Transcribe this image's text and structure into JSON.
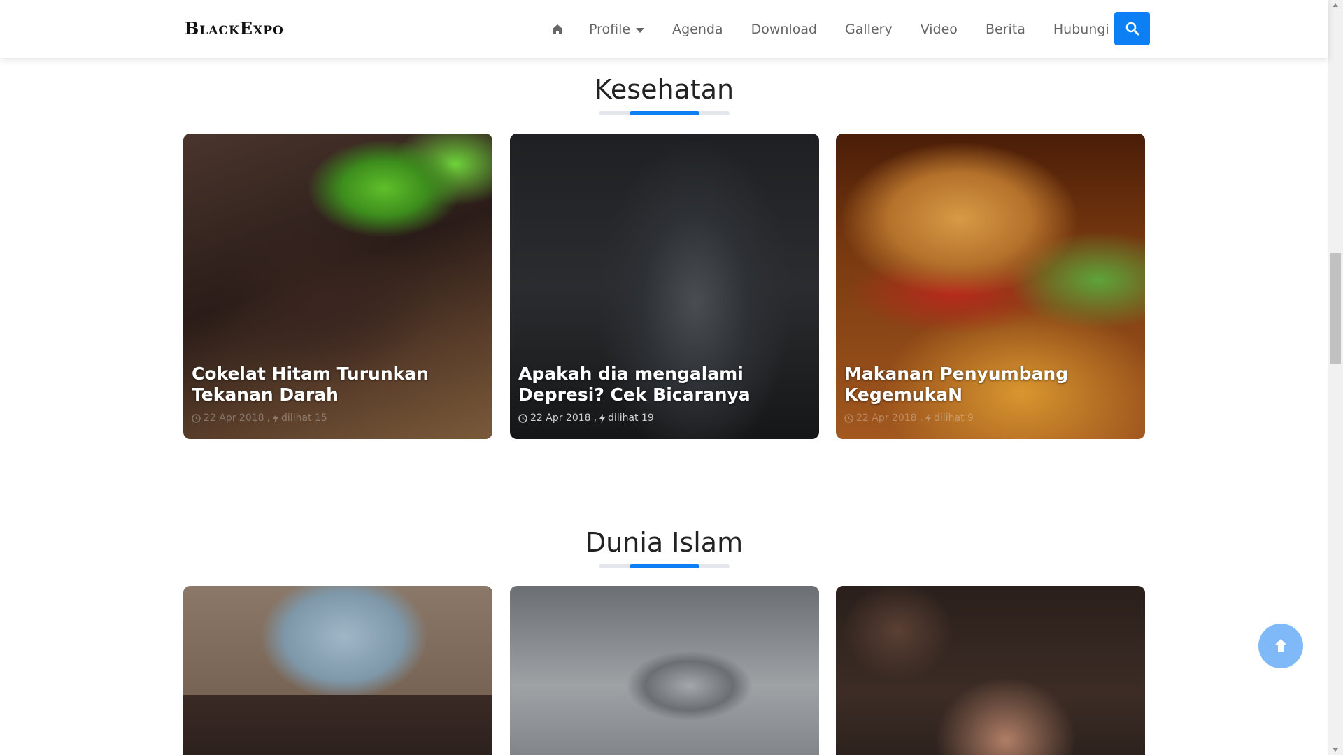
{
  "brand": "BlackExpo",
  "nav": {
    "home_icon": "home-icon",
    "items": [
      "Profile",
      "Agenda",
      "Download",
      "Gallery",
      "Video",
      "Berita",
      "Hubungi"
    ],
    "search_icon": "search-icon"
  },
  "colors": {
    "accent": "#0d7ff5",
    "to_top": "#7fb9f7"
  },
  "sections": [
    {
      "title": "Kesehatan",
      "cards": [
        {
          "title": "Cokelat Hitam Turunkan Tekanan Darah",
          "date": "22 Apr 2018",
          "views": "dilihat 15"
        },
        {
          "title": "Apakah dia mengalami Depresi? Cek Bicaranya",
          "date": "22 Apr 2018",
          "views": "dilihat 19"
        },
        {
          "title": "Makanan Penyumbang KegemukaN",
          "date": "22 Apr 2018",
          "views": "dilihat 9"
        }
      ]
    },
    {
      "title": "Dunia Islam",
      "cards": [
        {
          "title": ""
        },
        {
          "title": ""
        },
        {
          "title": ""
        }
      ]
    }
  ],
  "back_to_top_icon": "arrow-up-icon"
}
